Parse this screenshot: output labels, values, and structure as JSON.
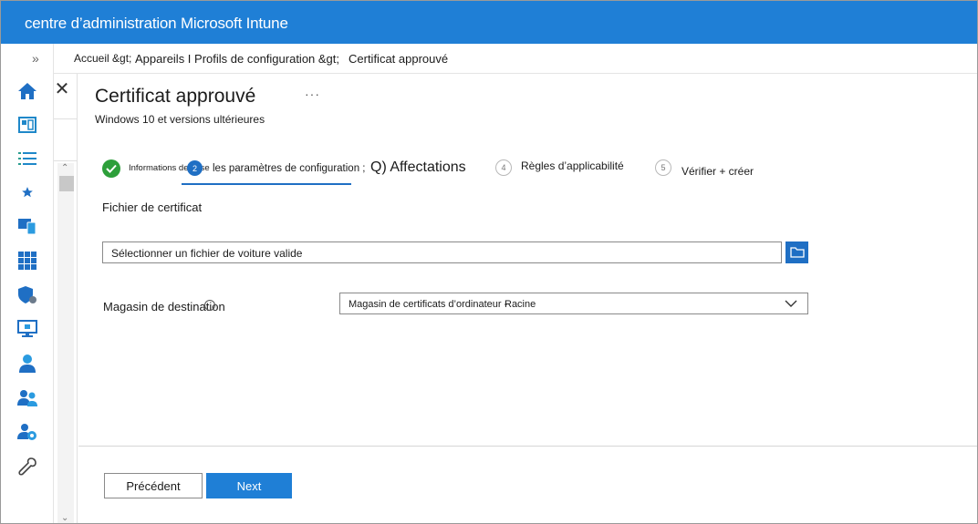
{
  "header": {
    "title": "centre d’administration Microsoft Intune"
  },
  "breadcrumb": {
    "home": "Accueil &gt;",
    "devices": "Appareils I Profils de configuration &gt;",
    "current": "Certificat approuvé"
  },
  "rail": {
    "expand_icon": "double-chevron-right-icon",
    "items": [
      "home-icon",
      "dashboard-icon",
      "list-icon",
      "star-icon",
      "devices-icon",
      "apps-icon",
      "shield-icon",
      "monitor-icon",
      "user-icon",
      "group-icon",
      "admin-gear-icon",
      "wrench-icon"
    ]
  },
  "page": {
    "title": "Certificat approuvé",
    "more": "···",
    "subtitle": "Windows 10 et versions ultérieures"
  },
  "steps": [
    {
      "label": "Informations de base",
      "number": "",
      "state": "done"
    },
    {
      "label": "les paramètres de configuration ;",
      "number": "2",
      "state": "active"
    },
    {
      "label": "Q) Affectations",
      "number": "",
      "state": "todo"
    },
    {
      "label": "Règles d’applicabilité",
      "number": "4",
      "state": "todo"
    },
    {
      "label": "Vérifier + créer",
      "number": "5",
      "state": "todo"
    }
  ],
  "form": {
    "certificate_label": "Fichier de certificat",
    "file_placeholder": "Sélectionner un fichier de voiture valide",
    "store_label": "Magasin de destination",
    "store_value_part1": "Magasin de certificats d’ordinateur -",
    "store_value_part2": "Racine"
  },
  "footer": {
    "previous_label": "Précédent",
    "next_label": "Next"
  },
  "colors": {
    "header_bg": "#1f7fd6",
    "accent": "#1f6fc4",
    "success": "#2d9f3a"
  }
}
